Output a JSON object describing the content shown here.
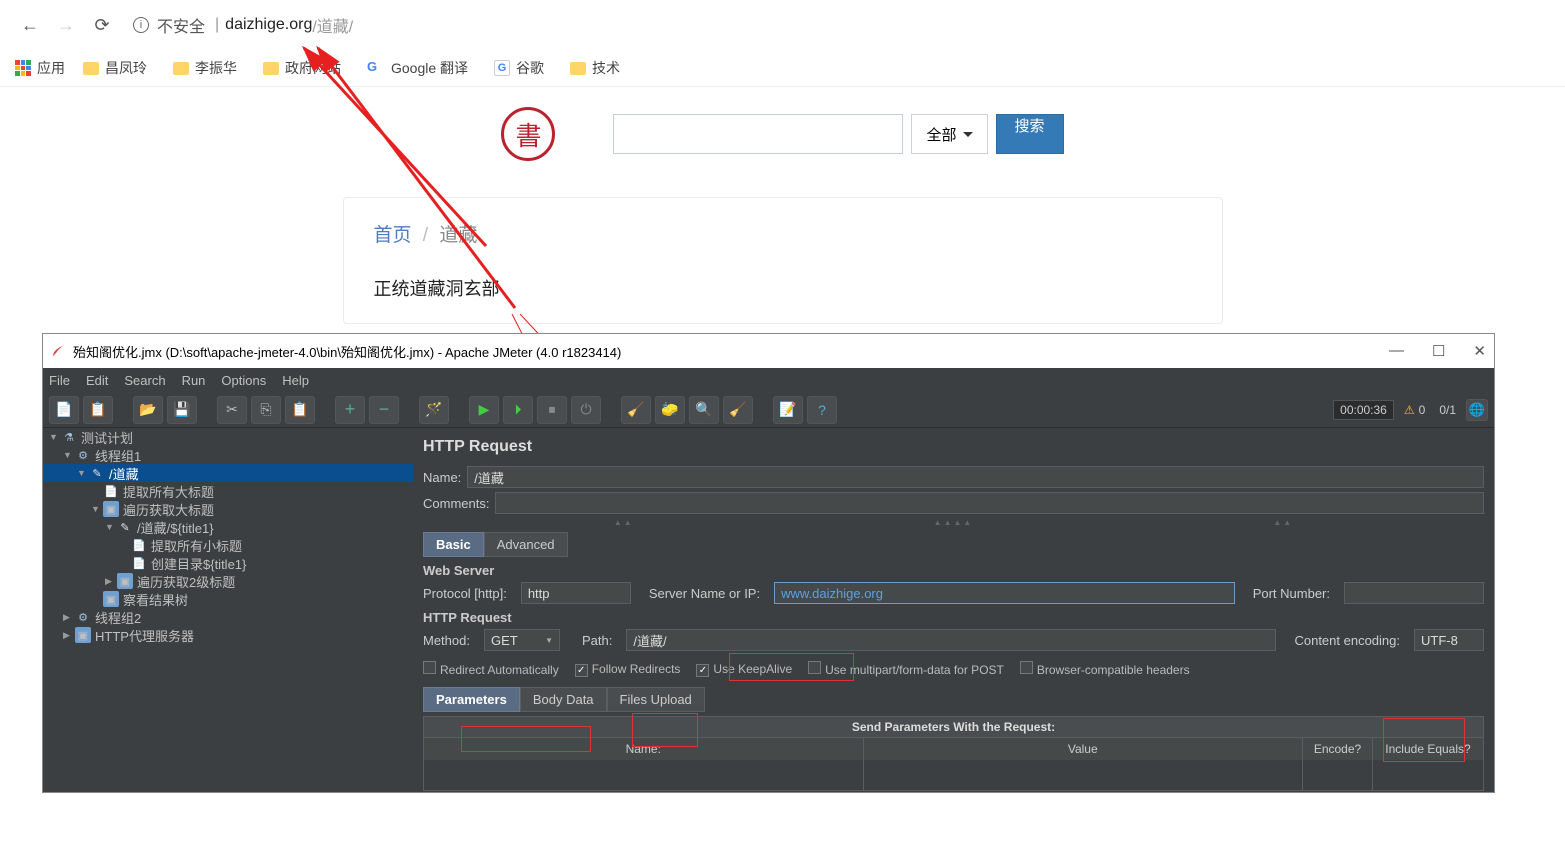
{
  "browser": {
    "insecure_label": "不安全",
    "domain": "daizhige.org",
    "path": "/道藏/",
    "apps_label": "应用",
    "bookmarks": [
      "昌凤玲",
      "李振华",
      "政府网站",
      "Google 翻译",
      "谷歌",
      "技术"
    ]
  },
  "page": {
    "logo_char": "書",
    "dropdown_label": "全部",
    "search_btn": "搜索",
    "bc_home": "首页",
    "bc_sep": "/",
    "bc_current": "道藏",
    "category": "正统道藏洞玄部"
  },
  "jmeter": {
    "title": "殆知阁优化.jmx (D:\\soft\\apache-jmeter-4.0\\bin\\殆知阁优化.jmx) - Apache JMeter (4.0 r1823414)",
    "menus": [
      "File",
      "Edit",
      "Search",
      "Run",
      "Options",
      "Help"
    ],
    "timer": "00:00:36",
    "warn_count": "0",
    "threads": "0/1",
    "tree": [
      {
        "d": 1,
        "tw": "▼",
        "ic": "flask",
        "label": "测试计划"
      },
      {
        "d": 2,
        "tw": "▼",
        "ic": "gear",
        "label": "线程组1"
      },
      {
        "d": 3,
        "tw": "▼",
        "ic": "slash",
        "label": "/道藏",
        "sel": true
      },
      {
        "d": 4,
        "tw": "",
        "ic": "doc",
        "label": "提取所有大标题"
      },
      {
        "d": 4,
        "tw": "▼",
        "ic": "square",
        "label": "遍历获取大标题"
      },
      {
        "d": 5,
        "tw": "▼",
        "ic": "slash",
        "label": "/道藏/${title1}"
      },
      {
        "d": 6,
        "tw": "",
        "ic": "doc",
        "label": "提取所有小标题"
      },
      {
        "d": 6,
        "tw": "",
        "ic": "doc",
        "label": "创建目录${title1}"
      },
      {
        "d": 5,
        "tw": "▶",
        "ic": "square",
        "label": "遍历获取2级标题"
      },
      {
        "d": 4,
        "tw": "",
        "ic": "square",
        "label": "察看结果树"
      },
      {
        "d": 2,
        "tw": "▶",
        "ic": "gear",
        "label": "线程组2"
      },
      {
        "d": 2,
        "tw": "▶",
        "ic": "square",
        "label": "HTTP代理服务器"
      }
    ],
    "panel": {
      "title": "HTTP Request",
      "name_label": "Name:",
      "name_value": "/道藏",
      "comments_label": "Comments:",
      "tab_basic": "Basic",
      "tab_advanced": "Advanced",
      "section_webserver": "Web Server",
      "protocol_label": "Protocol [http]:",
      "protocol_value": "http",
      "server_label": "Server Name or IP:",
      "server_value": "www.daizhige.org",
      "port_label": "Port Number:",
      "port_value": "",
      "section_http": "HTTP Request",
      "method_label": "Method:",
      "method_value": "GET",
      "path_label": "Path:",
      "path_value": "/道藏/",
      "encoding_label": "Content encoding:",
      "encoding_value": "UTF-8",
      "chk_redirect_auto": "Redirect Automatically",
      "chk_follow_redirect": "Follow Redirects",
      "chk_keepalive": "Use KeepAlive",
      "chk_multipart": "Use multipart/form-data for POST",
      "chk_browser_compat": "Browser-compatible headers",
      "sub_tab_params": "Parameters",
      "sub_tab_body": "Body Data",
      "sub_tab_files": "Files Upload",
      "params_title": "Send Parameters With the Request:",
      "col_name": "Name:",
      "col_value": "Value",
      "col_encode": "Encode?",
      "col_include": "Include Equals?"
    }
  }
}
